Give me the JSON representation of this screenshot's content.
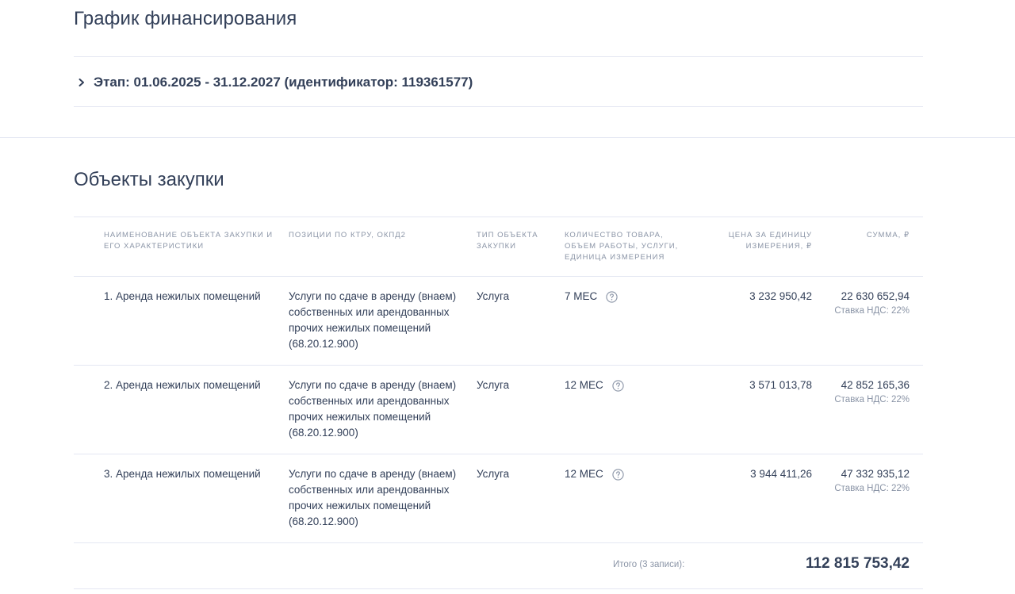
{
  "financing": {
    "title": "График финансирования",
    "stage_label": "Этап: 01.06.2025 - 31.12.2027 (идентификатор: 119361577)"
  },
  "objects": {
    "title": "Объекты закупки",
    "headers": {
      "name": "НАИМЕНОВАНИЕ ОБЪЕКТА ЗАКУПКИ И ЕГО ХАРАКТЕРИСТИКИ",
      "positions": "ПОЗИЦИИ ПО КТРУ, ОКПД2",
      "type": "ТИП ОБЪЕКТА ЗАКУПКИ",
      "quantity": "КОЛИЧЕСТВО ТОВАРА, ОБЪЕМ РАБОТЫ, УСЛУГИ, ЕДИНИЦА ИЗМЕРЕНИЯ",
      "price": "ЦЕНА ЗА ЕДИНИЦУ ИЗМЕРЕНИЯ, ₽",
      "sum": "СУММА, ₽"
    },
    "rows": [
      {
        "name": "1. Аренда нежилых помещений",
        "position": "Услуги по сдаче в аренду (внаем) собственных или арендованных прочих нежилых помещений (68.20.12.900)",
        "type": "Услуга",
        "quantity": "7 МЕС",
        "price": "3 232 950,42",
        "sum": "22 630 652,94",
        "vat": "Ставка НДС: 22%"
      },
      {
        "name": "2. Аренда нежилых помещений",
        "position": "Услуги по сдаче в аренду (внаем) собственных или арендованных прочих нежилых помещений (68.20.12.900)",
        "type": "Услуга",
        "quantity": "12 МЕС",
        "price": "3 571 013,78",
        "sum": "42 852 165,36",
        "vat": "Ставка НДС: 22%"
      },
      {
        "name": "3. Аренда нежилых помещений",
        "position": "Услуги по сдаче в аренду (внаем) собственных или арендованных прочих нежилых помещений (68.20.12.900)",
        "type": "Услуга",
        "quantity": "12 МЕС",
        "price": "3 944 411,26",
        "sum": "47 332 935,12",
        "vat": "Ставка НДС: 22%"
      }
    ],
    "total_label": "Итого (3 записи):",
    "total_value": "112 815 753,42"
  }
}
